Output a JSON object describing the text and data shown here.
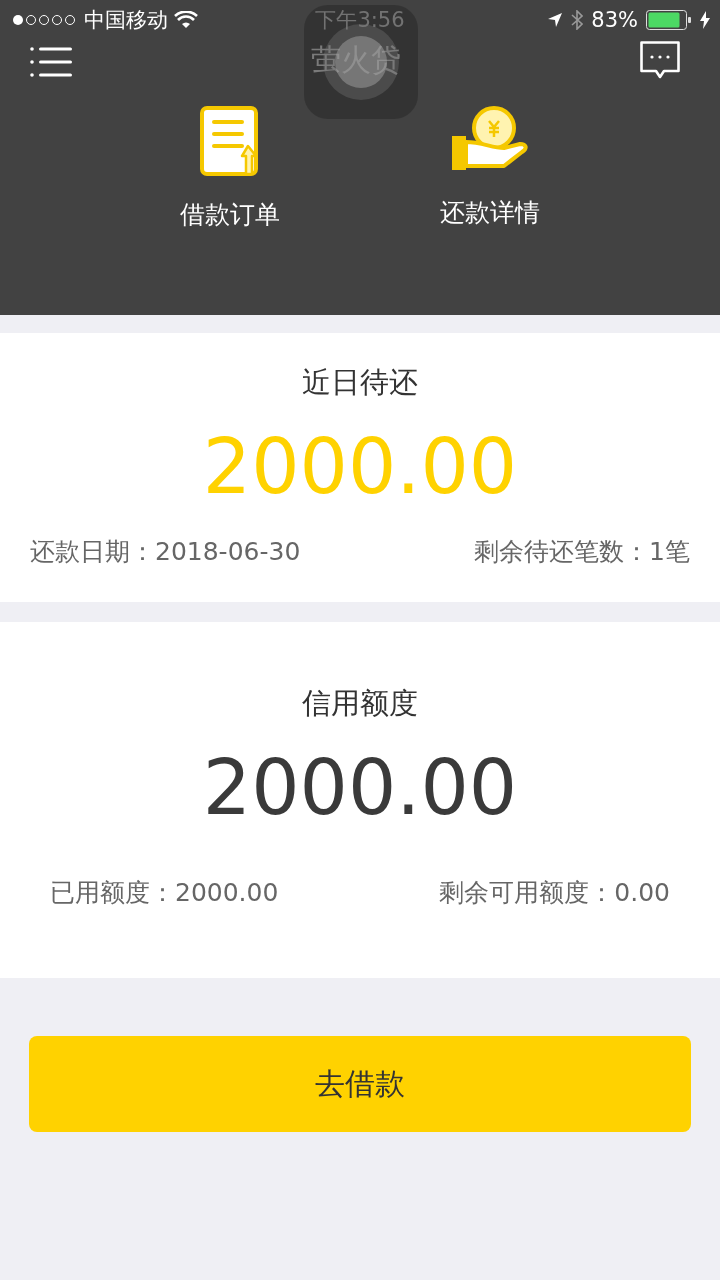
{
  "status_bar": {
    "carrier": "中国移动",
    "time": "下午3:56",
    "battery": "83%",
    "charging": true
  },
  "nav": {
    "title": "萤火贷"
  },
  "shortcuts": [
    {
      "kind": "order",
      "label": "借款订单"
    },
    {
      "kind": "repay",
      "label": "还款详情"
    }
  ],
  "due_card": {
    "title": "近日待还",
    "amount": "2000.00",
    "date": "还款日期：2018-06-30",
    "remaining": "剩余待还笔数：1笔"
  },
  "credit_card": {
    "title": "信用额度",
    "amount": "2000.00",
    "used": "已用额度：2000.00",
    "available": "剩余可用额度：0.00"
  },
  "borrow_button": "去借款"
}
